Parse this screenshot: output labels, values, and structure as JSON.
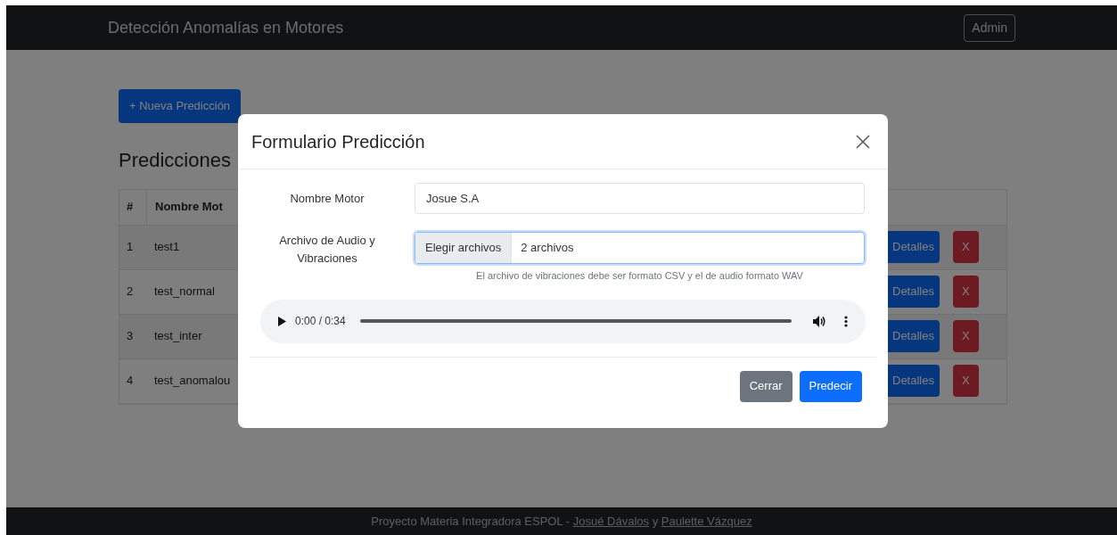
{
  "navbar": {
    "brand": "Detección Anomalías en Motores",
    "user_button": "Admin"
  },
  "new_button": "+ Nueva Predicción",
  "heading": "Predicciones",
  "table": {
    "columns": [
      "#",
      "Nombre Mot"
    ],
    "rows": [
      {
        "index": "1",
        "name": "test1",
        "details": "Detalles",
        "delete": "X"
      },
      {
        "index": "2",
        "name": "test_normal",
        "details": "Detalles",
        "delete": "X"
      },
      {
        "index": "3",
        "name": "test_inter",
        "details": "Detalles",
        "delete": "X"
      },
      {
        "index": "4",
        "name": "test_anomalou",
        "details": "Detalles",
        "delete": "X"
      }
    ]
  },
  "modal": {
    "title": "Formulario Predicción",
    "name_label": "Nombre Motor",
    "name_value": "Josue S.A",
    "file_label": "Archivo de Audio y Vibraciones",
    "file_button": "Elegir archivos",
    "file_value": "2 archivos",
    "file_focused": true,
    "file_help": "El archivo de vibraciones debe ser formato CSV y el de audio formato WAV",
    "audio": {
      "time": "0:00 / 0:34"
    },
    "buttons": [
      {
        "label": "Cerrar",
        "kind": "secondary"
      },
      {
        "label": "Predecir",
        "kind": "primary"
      }
    ]
  },
  "footer": {
    "text": "Proyecto Materia Integradora ESPOL - ",
    "links": [
      "Josué Dávalos",
      "Paulette Vázquez"
    ],
    "joiner": " y "
  }
}
